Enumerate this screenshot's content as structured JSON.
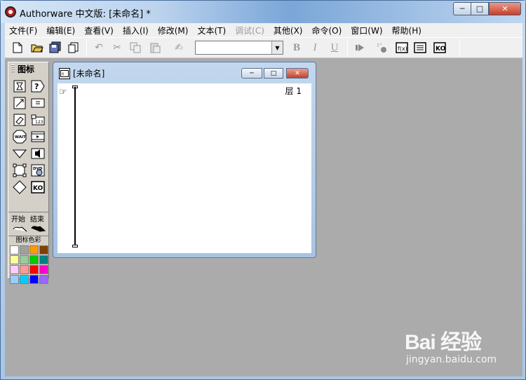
{
  "window": {
    "title": "Authorware 中文版: [未命名] *",
    "min_label": "─",
    "max_label": "□",
    "close_label": "✕"
  },
  "menu": [
    {
      "label": "文件(F)",
      "enabled": true
    },
    {
      "label": "编辑(E)",
      "enabled": true
    },
    {
      "label": "查看(V)",
      "enabled": true
    },
    {
      "label": "插入(I)",
      "enabled": true
    },
    {
      "label": "修改(M)",
      "enabled": true
    },
    {
      "label": "文本(T)",
      "enabled": true
    },
    {
      "label": "调试(C)",
      "enabled": false
    },
    {
      "label": "其他(X)",
      "enabled": true
    },
    {
      "label": "命令(O)",
      "enabled": true
    },
    {
      "label": "窗口(W)",
      "enabled": true
    },
    {
      "label": "帮助(H)",
      "enabled": true
    }
  ],
  "toolbar": {
    "font_value": "",
    "bold": "B",
    "italic": "I",
    "underline": "U"
  },
  "palette": {
    "title": "图标",
    "start_label": "开始",
    "end_label": "结束",
    "color_label": "图标色彩",
    "icons": [
      "display-icon",
      "interaction-icon",
      "motion-icon",
      "calculation-icon",
      "erase-icon",
      "map-icon",
      "wait-icon",
      "digital-movie-icon",
      "navigate-icon",
      "sound-icon",
      "framework-icon",
      "dvd-icon",
      "decision-icon",
      "knowledge-object-icon"
    ],
    "colors": [
      "#ffffff",
      "#a0a0a0",
      "#ff9900",
      "#804000",
      "#ffff99",
      "#99cc99",
      "#00cc00",
      "#008080",
      "#ffccff",
      "#ff9999",
      "#ff0000",
      "#ff00cc",
      "#99ccff",
      "#00ccff",
      "#0000ff",
      "#9966ff"
    ]
  },
  "child_window": {
    "title": "[未命名]",
    "layer_label": "层 1"
  },
  "watermark": {
    "brand": "Bai 经验",
    "url": "jingyan.baidu.com"
  }
}
